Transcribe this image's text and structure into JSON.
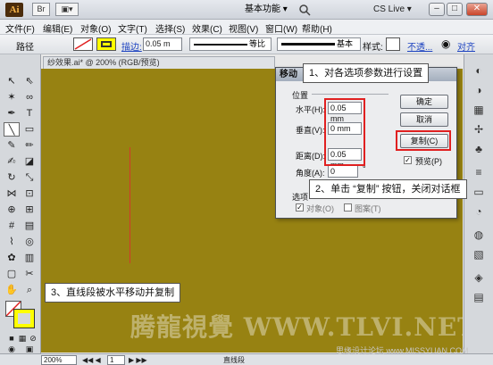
{
  "titlebar": {
    "logo": "Ai",
    "workspace": "基本功能 ▾",
    "cslive": "CS Live ▾",
    "min": "–",
    "max": "□",
    "close": "✕",
    "br_label": "Br",
    "view_label": "▣▾"
  },
  "menu": [
    "文件(F)",
    "编辑(E)",
    "对象(O)",
    "文字(T)",
    "选择(S)",
    "效果(C)",
    "视图(V)",
    "窗口(W)",
    "帮助(H)"
  ],
  "control": {
    "mode": "路径",
    "stroke_label": "描边:",
    "stroke_value": "0.05 m",
    "profile": "等比",
    "brush": "基本",
    "style_label": "样式:",
    "opacity_label": "不透...",
    "align_label": "对齐"
  },
  "document": {
    "tab": "纱效果.ai* @ 200% (RGB/预览)"
  },
  "dialog": {
    "title": "移动",
    "position_group": "位置",
    "horizontal_label": "水平(H):",
    "horizontal_value": "0.05 mm",
    "vertical_label": "垂直(V):",
    "vertical_value": "0 mm",
    "distance_label": "距离(D):",
    "distance_value": "0.05 mm",
    "angle_label": "角度(A):",
    "angle_value": "0",
    "angle_unit": "°",
    "ok": "确定",
    "cancel": "取消",
    "copy": "复制(C)",
    "preview": "预览(P)",
    "options_group": "选项",
    "objects_opt": "对象(O)",
    "patterns_opt": "图案(T)"
  },
  "callouts": {
    "c1": "1、对各选项参数进行设置",
    "c2": "2、单击 “复制” 按钮，关闭对话框",
    "c3": "3、直线段被水平移动并复制"
  },
  "watermark": "腾龍視覺 WWW.TLVI.NET",
  "corner_watermark": "思缘设计论坛 www.MISSYUAN.COM",
  "status": {
    "zoom": "200%",
    "page": "1",
    "tool": "直线段"
  },
  "colors": {
    "canvas": "#978212",
    "highlight": "#e02020",
    "stroke": "#d23a2a"
  }
}
